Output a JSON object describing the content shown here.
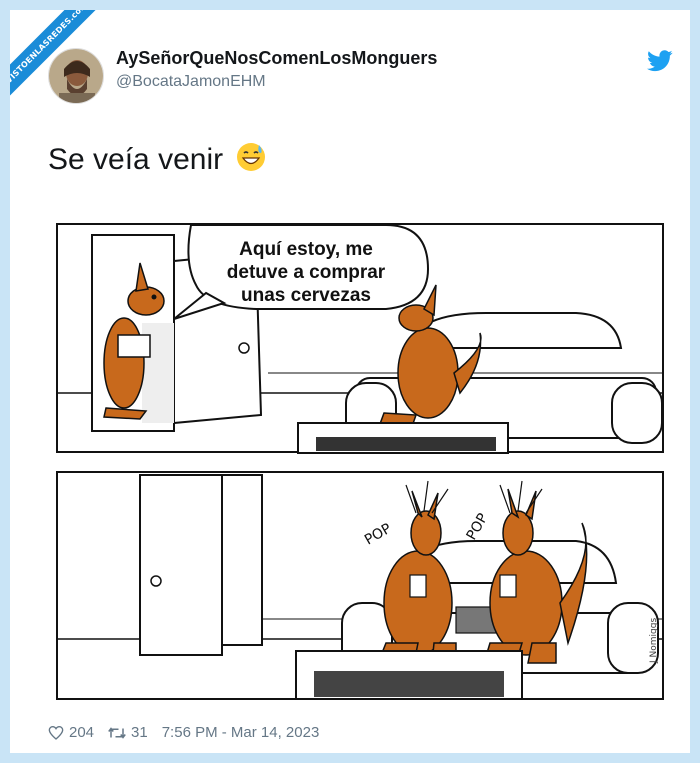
{
  "watermark": "VISTOENLASREDES.com",
  "user": {
    "name": "AySeñorQueNosComenLosMonguers",
    "handle": "@BocataJamonEHM"
  },
  "tweet": {
    "text": "Se veía venir",
    "emoji": "grinning-sweat-emoji"
  },
  "comic": {
    "speech_line1": "Aquí estoy, me",
    "speech_line2": "detuve a comprar",
    "speech_line3": "unas cervezas",
    "pop_left": "POP",
    "pop_right": "POP",
    "signature": "J Nomiggs"
  },
  "stats": {
    "likes": "204",
    "retweets": "31",
    "time": "7:56 PM - Mar 14, 2023"
  },
  "colors": {
    "brand": "#1da1f2",
    "text": "#14171a",
    "muted": "#657786",
    "kangaroo": "#c8691c"
  }
}
